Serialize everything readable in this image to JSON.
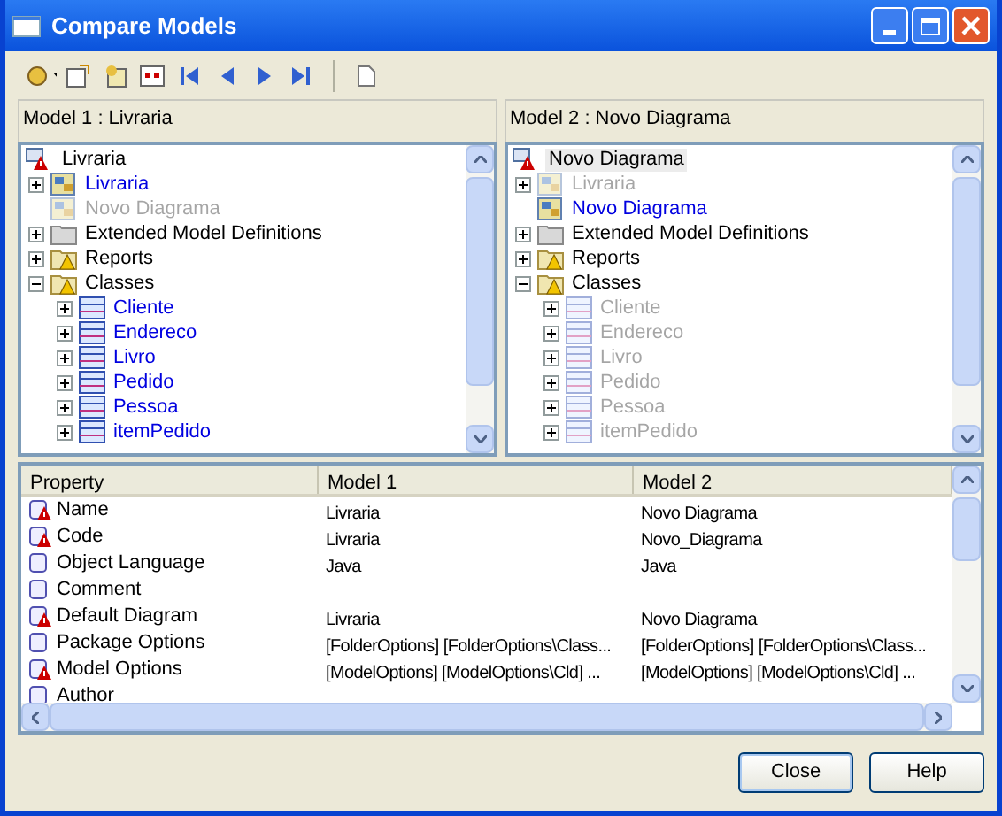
{
  "window": {
    "title": "Compare Models"
  },
  "panes": [
    {
      "header": "Model 1 : Livraria",
      "root": {
        "label": "Livraria",
        "selected": false
      },
      "items": [
        {
          "label": "Livraria",
          "kind": "diagram",
          "differs": true,
          "missing": false,
          "expanded": false
        },
        {
          "label": "Novo Diagrama",
          "kind": "diagram",
          "differs": false,
          "missing": true
        },
        {
          "label": "Extended Model Definitions",
          "kind": "folder",
          "differs": false,
          "missing": false,
          "expanded": false
        },
        {
          "label": "Reports",
          "kind": "warn_folder",
          "differs": false,
          "missing": false,
          "expanded": false
        },
        {
          "label": "Classes",
          "kind": "warn_folder",
          "differs": false,
          "missing": false,
          "expanded": true,
          "children": [
            {
              "label": "Cliente",
              "kind": "class",
              "differs": true,
              "missing": false,
              "expanded": false
            },
            {
              "label": "Endereco",
              "kind": "class",
              "differs": true,
              "missing": false,
              "expanded": false
            },
            {
              "label": "Livro",
              "kind": "class",
              "differs": true,
              "missing": false,
              "expanded": false
            },
            {
              "label": "Pedido",
              "kind": "class",
              "differs": true,
              "missing": false,
              "expanded": false
            },
            {
              "label": "Pessoa",
              "kind": "class",
              "differs": true,
              "missing": false,
              "expanded": false
            },
            {
              "label": "itemPedido",
              "kind": "class",
              "differs": true,
              "missing": false,
              "expanded": false
            }
          ]
        }
      ]
    },
    {
      "header": "Model 2 : Novo Diagrama",
      "root": {
        "label": "Novo Diagrama",
        "selected": true
      },
      "items": [
        {
          "label": "Livraria",
          "kind": "diagram",
          "differs": false,
          "missing": true,
          "expanded": false
        },
        {
          "label": "Novo Diagrama",
          "kind": "diagram",
          "differs": true,
          "missing": false
        },
        {
          "label": "Extended Model Definitions",
          "kind": "folder",
          "differs": false,
          "missing": false,
          "expanded": false
        },
        {
          "label": "Reports",
          "kind": "warn_folder",
          "differs": false,
          "missing": false,
          "expanded": false
        },
        {
          "label": "Classes",
          "kind": "warn_folder",
          "differs": false,
          "missing": false,
          "expanded": true,
          "children": [
            {
              "label": "Cliente",
              "kind": "class",
              "differs": false,
              "missing": true,
              "expanded": false
            },
            {
              "label": "Endereco",
              "kind": "class",
              "differs": false,
              "missing": true,
              "expanded": false
            },
            {
              "label": "Livro",
              "kind": "class",
              "differs": false,
              "missing": true,
              "expanded": false
            },
            {
              "label": "Pedido",
              "kind": "class",
              "differs": false,
              "missing": true,
              "expanded": false
            },
            {
              "label": "Pessoa",
              "kind": "class",
              "differs": false,
              "missing": true,
              "expanded": false
            },
            {
              "label": "itemPedido",
              "kind": "class",
              "differs": false,
              "missing": true,
              "expanded": false
            }
          ]
        }
      ]
    }
  ],
  "table": {
    "columns": [
      "Property",
      "Model 1",
      "Model 2"
    ],
    "rows": [
      {
        "kind": "differs",
        "cells": [
          "Name",
          "Livraria",
          "Novo Diagrama"
        ]
      },
      {
        "kind": "differs",
        "cells": [
          "Code",
          "Livraria",
          "Novo_Diagrama"
        ]
      },
      {
        "kind": "same",
        "cells": [
          "Object Language",
          "Java",
          "Java"
        ]
      },
      {
        "kind": "same",
        "cells": [
          "Comment",
          "",
          ""
        ]
      },
      {
        "kind": "differs",
        "cells": [
          "Default Diagram",
          "Livraria",
          "Novo Diagrama"
        ]
      },
      {
        "kind": "same",
        "cells": [
          "Package Options",
          "[FolderOptions]  [FolderOptions\\Class...",
          "[FolderOptions]  [FolderOptions\\Class..."
        ]
      },
      {
        "kind": "differs",
        "cells": [
          "Model Options",
          "[ModelOptions]  [ModelOptions\\Cld] ...",
          "[ModelOptions]  [ModelOptions\\Cld] ..."
        ]
      },
      {
        "kind": "same",
        "cells": [
          "Author",
          "",
          ""
        ]
      }
    ]
  },
  "buttons": [
    "Close",
    "Help"
  ]
}
